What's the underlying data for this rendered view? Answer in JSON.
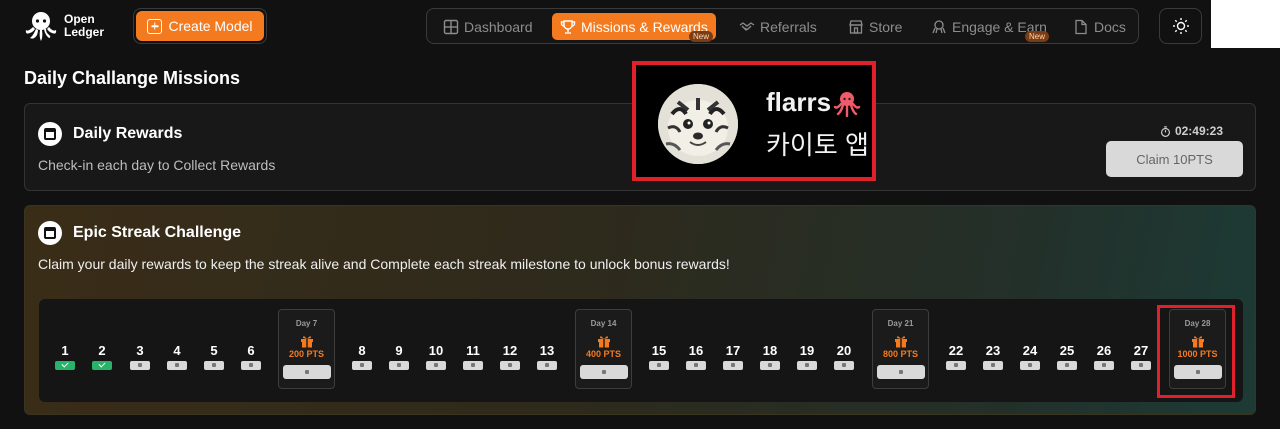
{
  "brand": {
    "line1": "Open",
    "line2": "Ledger"
  },
  "header": {
    "create_label": "Create Model",
    "nav": [
      {
        "label": "Dashboard",
        "icon": "grid-icon",
        "active": false
      },
      {
        "label": "Missions & Rewards",
        "icon": "trophy-icon",
        "active": true,
        "badge": "New"
      },
      {
        "label": "Referrals",
        "icon": "handshake-icon",
        "active": false
      },
      {
        "label": "Store",
        "icon": "store-icon",
        "active": false
      },
      {
        "label": "Engage & Earn",
        "icon": "engage-icon",
        "active": false,
        "badge": "New"
      },
      {
        "label": "Docs",
        "icon": "doc-icon",
        "active": false
      }
    ]
  },
  "page": {
    "title": "Daily Challange Missions"
  },
  "daily": {
    "title": "Daily Rewards",
    "subtitle": "Check-in each day to Collect Rewards",
    "timer": "02:49:23",
    "claim_label": "Claim 10PTS"
  },
  "overlay": {
    "name": "flarrs",
    "subtitle": "카이토 앱"
  },
  "epic": {
    "title": "Epic Streak Challenge",
    "subtitle": "Claim your daily rewards to keep the streak alive and Complete each streak milestone to unlock bonus rewards!",
    "days": [
      "1",
      "2",
      "3",
      "4",
      "5",
      "6",
      "8",
      "9",
      "10",
      "11",
      "12",
      "13",
      "15",
      "16",
      "17",
      "18",
      "19",
      "20",
      "22",
      "23",
      "24",
      "25",
      "26",
      "27"
    ],
    "completed_days": [
      "1",
      "2"
    ],
    "milestones": [
      {
        "day": "Day 7",
        "pts": "200 PTS"
      },
      {
        "day": "Day 14",
        "pts": "400 PTS"
      },
      {
        "day": "Day 21",
        "pts": "800 PTS"
      },
      {
        "day": "Day 28",
        "pts": "1000 PTS"
      }
    ]
  },
  "colors": {
    "accent": "#f47a1f",
    "success": "#28b36a",
    "highlight": "#e0202b"
  }
}
